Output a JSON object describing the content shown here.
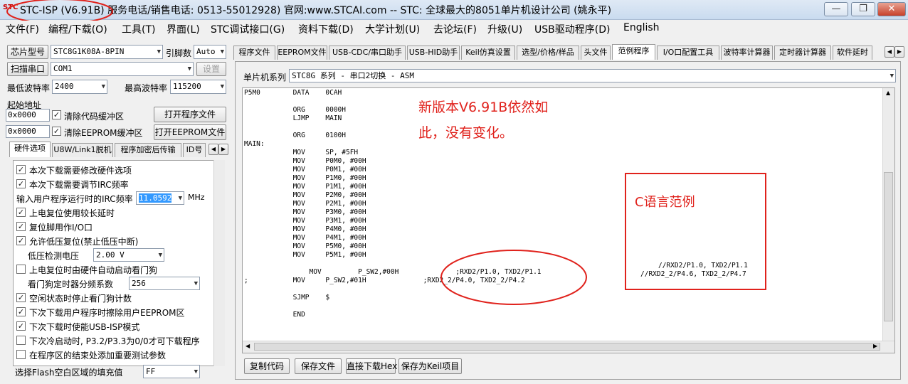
{
  "window": {
    "logo_text": "STC",
    "title": "STC-ISP (V6.91B) 服务电话/销售电话: 0513-55012928) 官网:www.STCAI.com  -- STC: 全球最大的8051单片机设计公司 (姚永平)",
    "minimize": "—",
    "restore": "❐",
    "close": "✕"
  },
  "menu": [
    "文件(F)",
    "编程/下载(O)",
    "工具(T)",
    "界面(L)",
    "STC调试接口(G)",
    "资料下载(D)",
    "大学计划(U)",
    "去论坛(F)",
    "升级(U)",
    "USB驱动程序(D)",
    "English"
  ],
  "left": {
    "chip_button": "芯片型号",
    "chip_value": "STC8G1K08A-8PIN",
    "pins_label": "引脚数",
    "pins_value": "Auto",
    "scan_button": "扫描串口",
    "port_value": "COM1",
    "settings_button": "设置",
    "min_baud_label": "最低波特率",
    "min_baud_value": "2400",
    "max_baud_label": "最高波特率",
    "max_baud_value": "115200",
    "start_addr_label": "起始地址",
    "addr1": "0x0000",
    "clear_code_label": "清除代码缓冲区",
    "open_program_button": "打开程序文件",
    "addr2": "0x0000",
    "clear_eeprom_label": "清除EEPROM缓冲区",
    "open_eeprom_button": "打开EEPROM文件",
    "tabs": [
      "硬件选项",
      "U8W/Link1脱机",
      "程序加密后传输",
      "ID号"
    ],
    "options": [
      {
        "label": "本次下载需要修改硬件选项",
        "checked": true
      },
      {
        "label": "本次下载需要调节IRC频率",
        "checked": true
      }
    ],
    "irc_label": "输入用户程序运行时的IRC频率",
    "irc_value": "11.0592",
    "irc_unit": "MHz",
    "options2": [
      {
        "label": "上电复位使用较长延时",
        "checked": true
      },
      {
        "label": "复位脚用作I/O口",
        "checked": true
      },
      {
        "label": "允许低压复位(禁止低压中断)",
        "checked": true
      }
    ],
    "lvd_label": "低压检测电压",
    "lvd_value": "2.00 V",
    "wdt_auto_label": "上电复位时由硬件自动启动看门狗",
    "wdt_div_label": "看门狗定时器分频系数",
    "wdt_div_value": "256",
    "options3": [
      {
        "label": "空闲状态时停止看门狗计数",
        "checked": true
      },
      {
        "label": "下次下载用户程序时擦除用户EEPROM区",
        "checked": true
      },
      {
        "label": "下次下载时使能USB-ISP模式",
        "checked": true
      },
      {
        "label": "下次冷启动时, P3.2/P3.3为0/0才可下载程序",
        "checked": false
      },
      {
        "label": "在程序区的结束处添加重要测试参数",
        "checked": false
      }
    ],
    "fill_label": "选择Flash空白区域的填充值",
    "fill_value": "FF"
  },
  "right": {
    "tabs": [
      "程序文件",
      "EEPROM文件",
      "USB-CDC/串口助手",
      "USB-HID助手",
      "Keil仿真设置",
      "选型/价格/样品",
      "头文件",
      "范例程序",
      "I/O口配置工具",
      "波特率计算器",
      "定时器计算器",
      "软件延时"
    ],
    "active_tab": "范例程序",
    "series_label": "单片机系列",
    "series_value": "STC8G 系列 - 串口2切换 - ASM",
    "code_lines": [
      "P5M0        DATA    0CAH",
      "",
      "            ORG     0000H",
      "            LJMP    MAIN",
      "",
      "            ORG     0100H",
      "MAIN:",
      "            MOV     SP, #5FH",
      "            MOV     P0M0, #00H",
      "            MOV     P0M1, #00H",
      "            MOV     P1M0, #00H",
      "            MOV     P1M1, #00H",
      "            MOV     P2M0, #00H",
      "            MOV     P2M1, #00H",
      "            MOV     P3M0, #00H",
      "            MOV     P3M1, #00H",
      "            MOV     P4M0, #00H",
      "            MOV     P4M1, #00H",
      "            MOV     P5M0, #00H",
      "            MOV     P5M1, #00H",
      "",
      "                MOV         P_SW2,#00H              ;RXD2/P1.0, TXD2/P1.1",
      ";           MOV     P_SW2,#01H              ;RXD2_2/P4.0, TXD2_2/P4.2",
      "",
      "            SJMP    $",
      "",
      "            END"
    ],
    "c_comment_1": "//RXD2/P1.0, TXD2/P1.1",
    "c_comment_2": "//RXD2_2/P4.6, TXD2_2/P4.7",
    "buttons": [
      "复制代码",
      "保存文件",
      "直接下载Hex",
      "保存为Keil项目"
    ]
  },
  "annotations": {
    "note_line1": "新版本V6.91B依然如",
    "note_line2": "此，没有变化。",
    "c_example": "C语言范例"
  },
  "colors": {
    "annotation": "#e0221c",
    "selection": "#3399ff"
  }
}
